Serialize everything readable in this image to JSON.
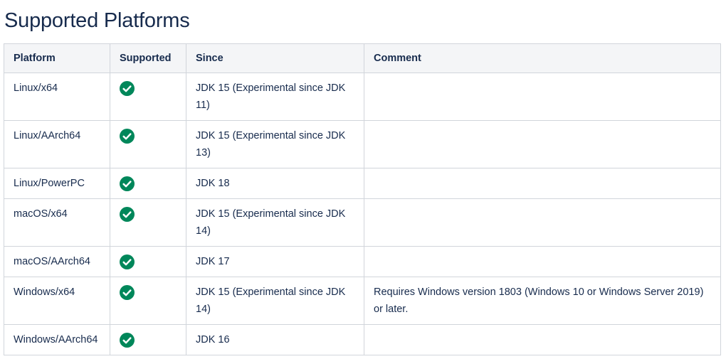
{
  "page": {
    "title": "Supported Platforms"
  },
  "table": {
    "headers": [
      "Platform",
      "Supported",
      "Since",
      "Comment"
    ],
    "rows": [
      {
        "platform": "Linux/x64",
        "supported": true,
        "since": "JDK 15 (Experimental since JDK 11)",
        "comment": ""
      },
      {
        "platform": "Linux/AArch64",
        "supported": true,
        "since": "JDK 15 (Experimental since JDK 13)",
        "comment": ""
      },
      {
        "platform": "Linux/PowerPC",
        "supported": true,
        "since": "JDK 18",
        "comment": ""
      },
      {
        "platform": "macOS/x64",
        "supported": true,
        "since": "JDK 15 (Experimental since JDK 14)",
        "comment": ""
      },
      {
        "platform": "macOS/AArch64",
        "supported": true,
        "since": "JDK 17",
        "comment": ""
      },
      {
        "platform": "Windows/x64",
        "supported": true,
        "since": "JDK 15 (Experimental since JDK 14)",
        "comment": "Requires Windows version 1803 (Windows 10 or Windows Server 2019) or later."
      },
      {
        "platform": "Windows/AArch64",
        "supported": true,
        "since": "JDK 16",
        "comment": ""
      }
    ]
  },
  "icons": {
    "supported": "check-circle-icon"
  },
  "colors": {
    "check": "#00875a",
    "header_bg": "#f4f5f7",
    "border": "#d1d5db",
    "text": "#172b4d"
  }
}
